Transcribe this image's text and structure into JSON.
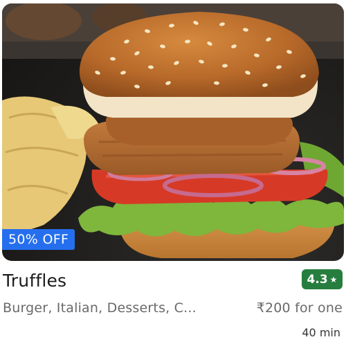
{
  "restaurant": {
    "name": "Truffles",
    "rating": "4.3",
    "cuisines": "Burger, Italian, Desserts, C...",
    "price": "₹200 for one",
    "delivery_time": "40 min",
    "offer": "50% OFF",
    "image": "burger-photo"
  },
  "colors": {
    "rating_badge": "#267e3e",
    "offer_badge": "#256fef",
    "secondary_text": "#696969"
  },
  "icons": {
    "rating": "star-icon"
  }
}
